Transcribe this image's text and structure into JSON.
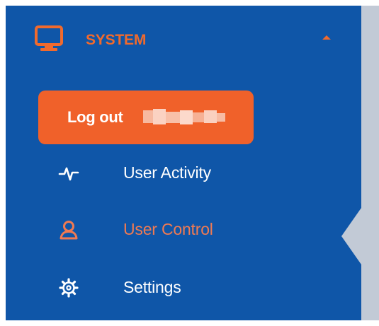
{
  "sidebar": {
    "section": {
      "title": "SYSTEM",
      "icon": "monitor-icon",
      "expanded": true
    },
    "logout": {
      "label": "Log out"
    },
    "items": [
      {
        "label": "User Activity",
        "icon": "activity-pulse-icon",
        "active": false
      },
      {
        "label": "User Control",
        "icon": "user-icon",
        "active": true
      },
      {
        "label": "Settings",
        "icon": "gear-icon",
        "active": false
      }
    ]
  },
  "colors": {
    "sidebar_bg": "#0f56a8",
    "accent": "#f0612a",
    "active_text": "#f07a52",
    "text": "#ffffff",
    "content_bg": "#c2cad6"
  }
}
